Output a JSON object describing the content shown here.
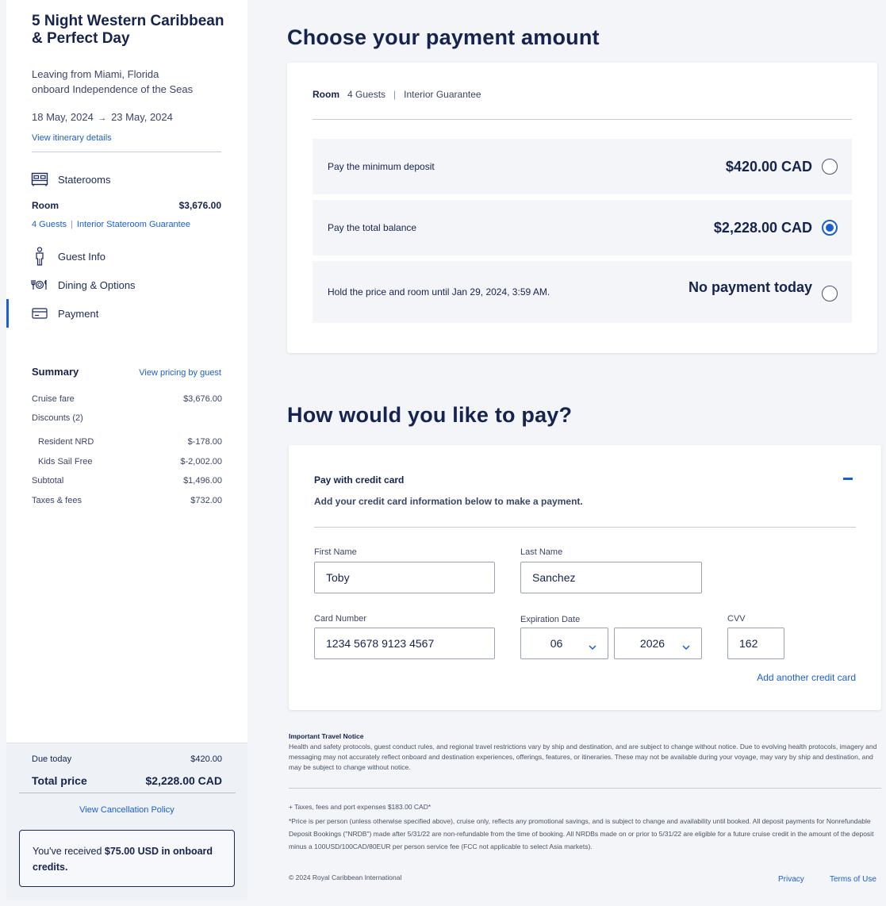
{
  "sidebar": {
    "trip_title": "5 Night Western Caribbean & Perfect Day",
    "leaving_line1": "Leaving from Miami, Florida",
    "leaving_line2": "onboard Independence of the Seas",
    "date_start": "18 May, 2024",
    "date_arrow": "→",
    "date_end": "23 May, 2024",
    "itinerary_link": "View itinerary details",
    "nav": {
      "staterooms": "Staterooms",
      "guest_info": "Guest Info",
      "dining": "Dining & Options",
      "payment": "Payment"
    },
    "room_label": "Room",
    "room_price": "$3,676.00",
    "room_guests": "4 Guests",
    "room_sep": "|",
    "room_type": "Interior Stateroom Guarantee",
    "summary": {
      "title": "Summary",
      "pricing_link": "View pricing by guest",
      "rows": [
        {
          "label": "Cruise fare",
          "value": "$3,676.00"
        },
        {
          "label": "Discounts (2)",
          "value": ""
        },
        {
          "label": "Resident NRD",
          "value": "$-178.00"
        },
        {
          "label": "Kids Sail Free",
          "value": "$-2,002.00"
        },
        {
          "label": "Subtotal",
          "value": "$1,496.00"
        },
        {
          "label": "Taxes & fees",
          "value": "$732.00"
        }
      ]
    },
    "due_today_label": "Due today",
    "due_today_value": "$420.00",
    "total_label": "Total price",
    "total_value": "$2,228.00 CAD",
    "cancellation_link": "View Cancellation Policy",
    "credit_pre": "You've received ",
    "credit_amount": "$75.00 USD in onboard",
    "credit_post": "credits."
  },
  "payment_amount": {
    "heading": "Choose your payment amount",
    "room_label": "Room",
    "guests": "4 Guests",
    "sep": "|",
    "room_type": "Interior Guarantee",
    "options": [
      {
        "label": "Pay the minimum deposit",
        "amount": "$420.00 CAD",
        "selected": false
      },
      {
        "label": "Pay the total balance",
        "amount": "$2,228.00 CAD",
        "selected": true
      },
      {
        "label": "Hold the price and room until Jan 29, 2024, 3:59 AM.",
        "amount": "No payment today",
        "selected": false
      }
    ]
  },
  "pay_method": {
    "heading": "How would you like to pay?",
    "section_title": "Pay with credit card",
    "section_sub": "Add your credit card information below to make a payment.",
    "first_name_label": "First Name",
    "first_name": "Toby",
    "last_name_label": "Last Name",
    "last_name": "Sanchez",
    "card_number_label": "Card Number",
    "card_number": "1234 5678 9123 4567",
    "expiration_label": "Expiration Date",
    "exp_month": "06",
    "exp_year": "2026",
    "cvv_label": "CVV",
    "cvv": "162",
    "add_card_link": "Add another credit card"
  },
  "notice": {
    "title": "Important Travel Notice",
    "body": "Health and safety protocols, guest conduct rules, and regional travel restrictions vary by ship and destination, and are subject to change without notice. Due to evolving health protocols, imagery and messaging may not accurately reflect onboard and destination experiences, offerings, features, or itineraries. These may not be available during your voyage, may vary by ship and destination, and may be subject to change without notice.",
    "taxes_line": "+ Taxes, fees and port expenses $183.00 CAD*",
    "fine_print": "*Price is per person (unless otherwise specified above), cruise only, reflects any promotional savings, and is subject to change and availability until booked. All deposit payments for Nonrefundable Deposit Bookings (\"NRDB\") made after 5/31/22 are non-refundable from the time of booking. All NRDBs made on or prior to 5/31/22 are eligible for a future cruise credit in the amount of the deposit minus a 100USD/100CAD/80EUR per person service fee (FCC not applicable to select Asia markets)."
  },
  "footer": {
    "copyright": "© 2024 Royal Caribbean International",
    "privacy": "Privacy",
    "terms": "Terms of Use"
  },
  "colors": {
    "navy": "#15234e",
    "accent_blue": "#1a5fd0",
    "page_bg": "#f3f5f9"
  }
}
